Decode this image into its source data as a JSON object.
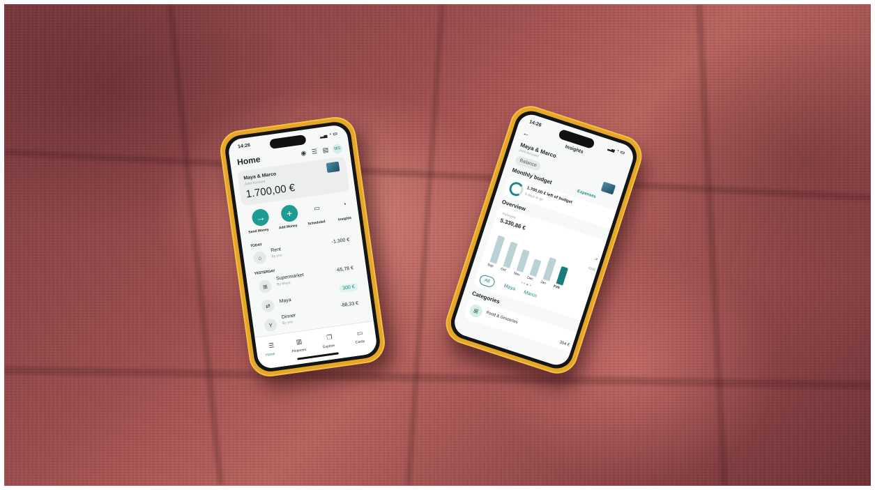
{
  "colors": {
    "accent": "#1e9b92",
    "phone_case": "#e7a726",
    "fabric": "#9c4b4c"
  },
  "phone_left": {
    "time": "14:26",
    "title": "Home",
    "initials": "MS",
    "account_name": "Maya & Marco",
    "account_type": "Joint Account",
    "balance": "1.700,00 €",
    "actions": [
      "Send Money",
      "Add Money",
      "Scheduled",
      "Insights"
    ],
    "sections": {
      "today": "TODAY",
      "yesterday": "YESTERDAY"
    },
    "transactions": [
      {
        "title": "Rent",
        "subtitle": "By you",
        "amount": "-1.300 €"
      },
      {
        "title": "Supermarket",
        "subtitle": "By Maya",
        "amount": "-65,78 €"
      },
      {
        "title": "Maya",
        "subtitle": "",
        "amount": "300 €"
      },
      {
        "title": "Dinner",
        "subtitle": "By you",
        "amount": "-88,33 €"
      }
    ],
    "nav": [
      "Home",
      "Finances",
      "Explore",
      "Cards"
    ]
  },
  "phone_right": {
    "time": "14:26",
    "back": "←",
    "title": "Insights",
    "account_name": "Maya & Marco",
    "account_type": "Joint Account",
    "tabs": {
      "balance": "Balance",
      "expenses": "Expenses"
    },
    "budget_title": "Monthly budget",
    "budget_left": "1.700,00 € left of budget",
    "budget_days": "8 days to go",
    "overview_title": "Overview",
    "month": "February",
    "month_total": "5.330,86 €",
    "chart_max": "430€",
    "filters": [
      "All",
      "Maya",
      "Marco"
    ],
    "categories_title": "Categories",
    "category": {
      "name": "Food & Groceries",
      "amount": "354 €"
    }
  },
  "chart_data": {
    "type": "bar",
    "categories": [
      "Sep",
      "Oct",
      "Nov",
      "Dec",
      "Jan",
      "Feb"
    ],
    "values": [
      0.92,
      0.85,
      0.72,
      0.55,
      0.75,
      0.6
    ],
    "highlighted": "Feb"
  }
}
